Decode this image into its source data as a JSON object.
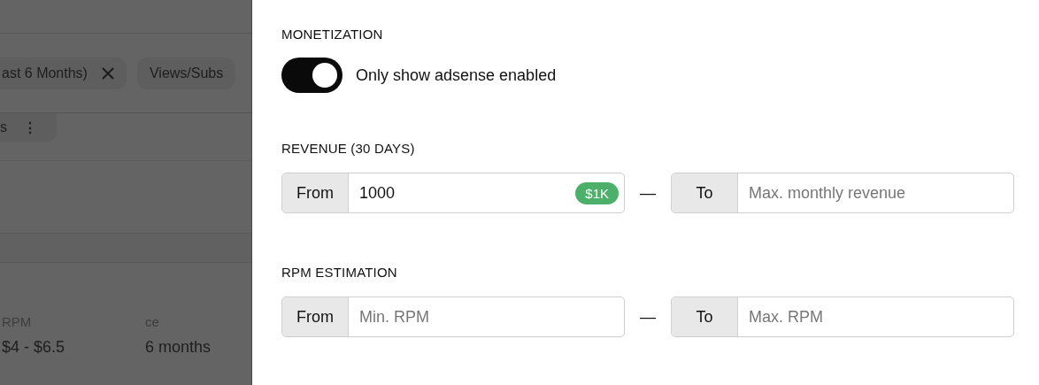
{
  "background": {
    "chips": [
      {
        "label": "ast 6 Months)",
        "removable": true
      },
      {
        "label": "Views/Subs",
        "removable": false
      }
    ],
    "menu_chip": {
      "label": "s",
      "icon": "⋮"
    },
    "stats": [
      {
        "label": "RPM",
        "value": "$4 - $6.5"
      },
      {
        "label": "ce",
        "value": "6 months"
      }
    ]
  },
  "filters": {
    "monetization": {
      "title": "MONETIZATION",
      "toggle": {
        "label": "Only show adsense enabled",
        "on": true
      }
    },
    "ranges": [
      {
        "title": "REVENUE (30 DAYS)",
        "from": {
          "addon": "From",
          "value": "1000",
          "badge": "$1K"
        },
        "separator": "—",
        "to": {
          "addon": "To",
          "placeholder": "Max. monthly revenue"
        }
      },
      {
        "title": "RPM ESTIMATION",
        "from": {
          "addon": "From",
          "placeholder": "Min. RPM"
        },
        "separator": "—",
        "to": {
          "addon": "To",
          "placeholder": "Max. RPM"
        }
      }
    ]
  }
}
